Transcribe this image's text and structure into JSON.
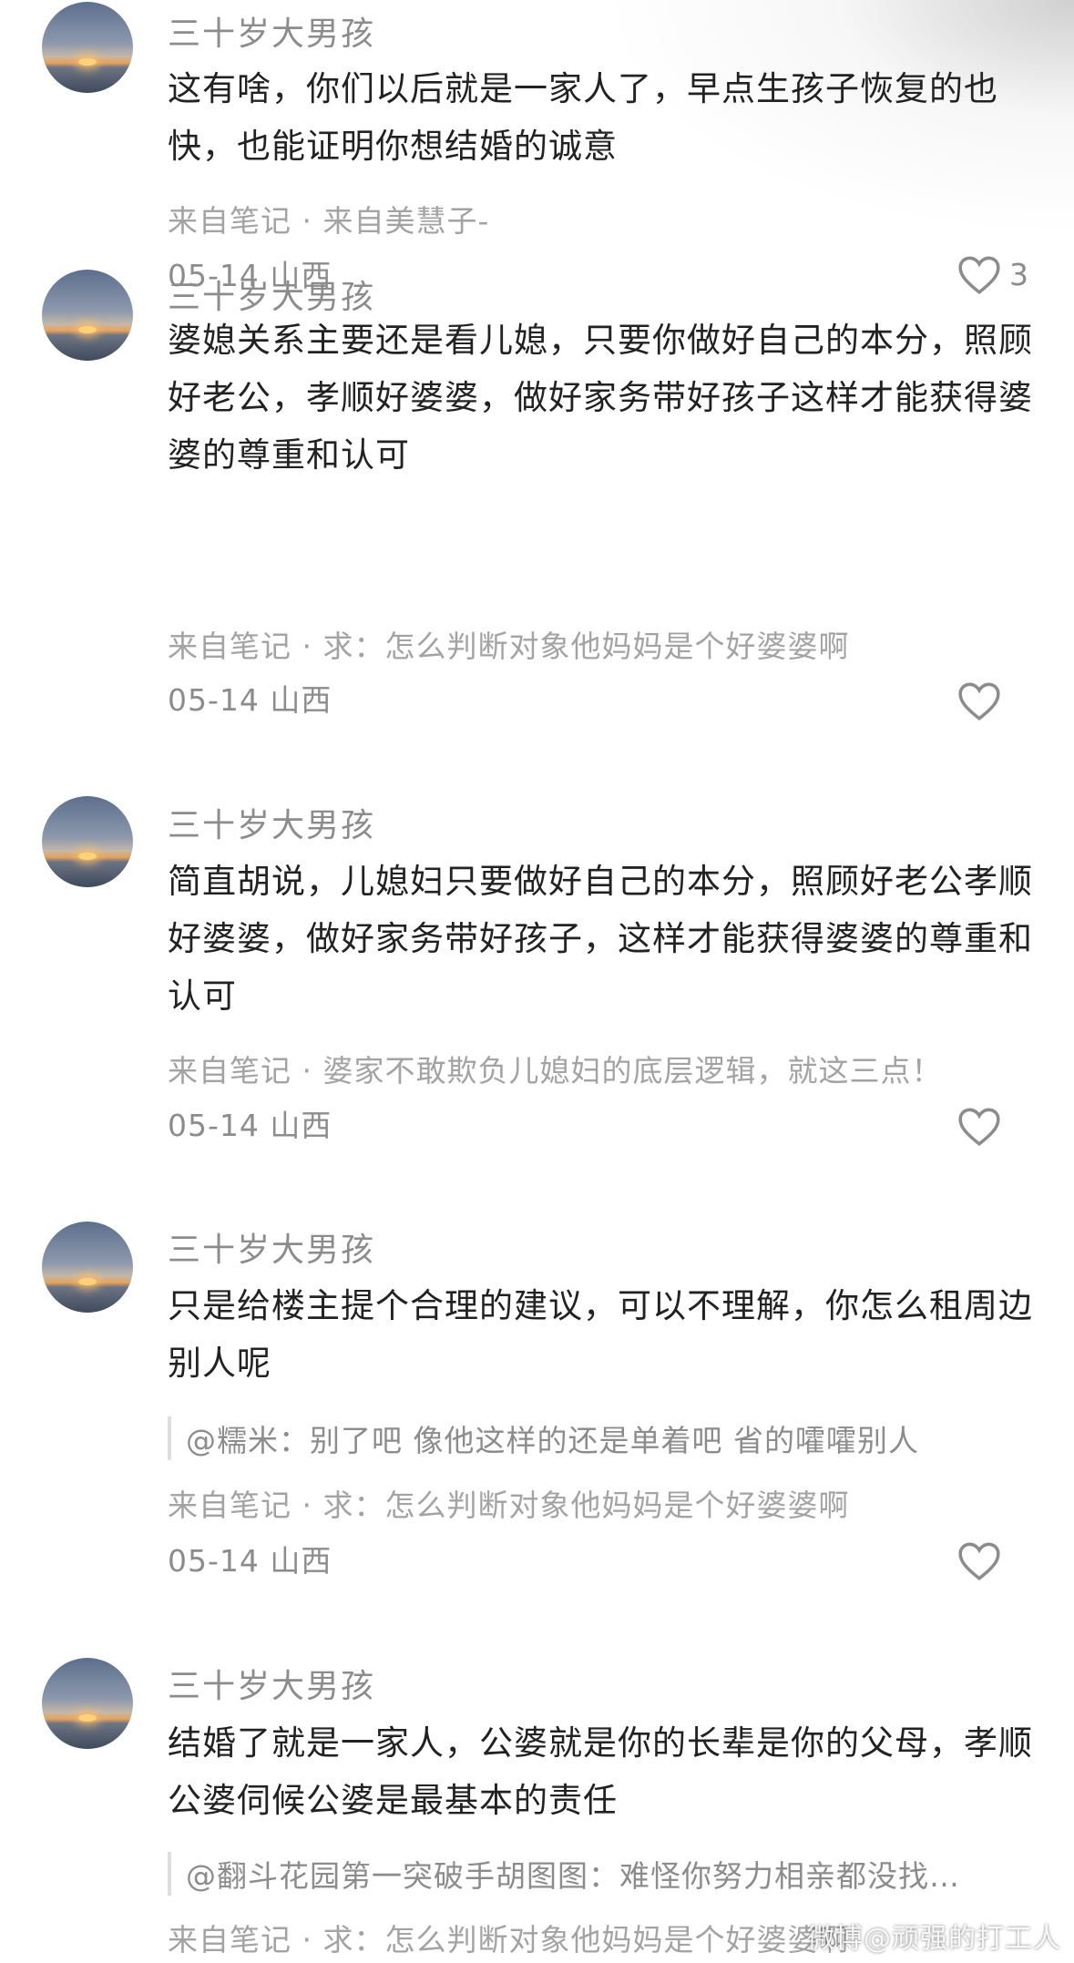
{
  "comments": [
    {
      "username": "三十岁大男孩",
      "content": "这有啥，你们以后就是一家人了，早点生孩子恢复的也快，也能证明你想结婚的诚意",
      "source": "来自笔记 · 来自美慧子-",
      "meta": "05-14 山西",
      "likes": "3"
    },
    {
      "username": "三十岁大男孩",
      "content": "婆媳关系主要还是看儿媳，只要你做好自己的本分，照顾好老公，孝顺好婆婆，做好家务带好孩子这样才能获得婆婆的尊重和认可",
      "source": "来自笔记 · 求：怎么判断对象他妈妈是个好婆婆啊",
      "meta": "05-14 山西",
      "likes": ""
    },
    {
      "username": "三十岁大男孩",
      "content": "简直胡说，儿媳妇只要做好自己的本分，照顾好老公孝顺好婆婆，做好家务带好孩子，这样才能获得婆婆的尊重和认可",
      "source": "来自笔记 · 婆家不敢欺负儿媳妇的底层逻辑，就这三点！",
      "meta": "05-14 山西",
      "likes": ""
    },
    {
      "username": "三十岁大男孩",
      "content": "只是给楼主提个合理的建议，可以不理解，你怎么租周边别人呢",
      "reply": "@糯米：别了吧 像他这样的还是单着吧 省的嚯嚯别人",
      "source": "来自笔记 · 求：怎么判断对象他妈妈是个好婆婆啊",
      "meta": "05-14 山西",
      "likes": ""
    },
    {
      "username": "三十岁大男孩",
      "content": "结婚了就是一家人，公婆就是你的长辈是你的父母，孝顺公婆伺候公婆是最基本的责任",
      "reply": "@翻斗花园第一突破手胡图图：难怪你努力相亲都没找…",
      "source": "来自笔记 · 求：怎么判断对象他妈妈是个好婆婆啊"
    }
  ],
  "watermark": "微博@顽强的打工人",
  "colors": {
    "text": "#222222",
    "secondary": "#8c8c8c",
    "background": "#ffffff"
  },
  "icons": {
    "like": "heart-outline-icon",
    "avatar": "sunset-avatar"
  }
}
